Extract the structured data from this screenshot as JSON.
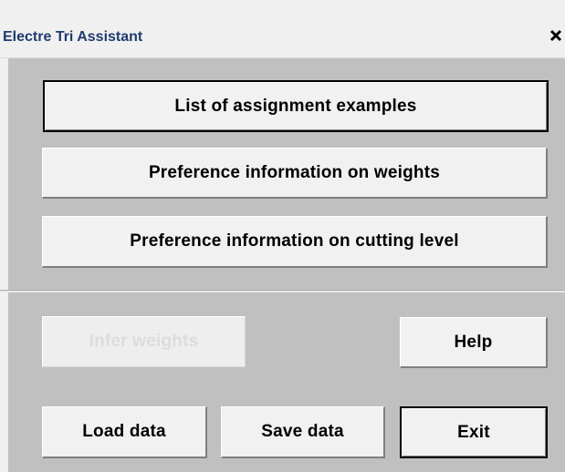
{
  "window": {
    "title": "Electre Tri Assistant",
    "close_glyph": "×"
  },
  "buttons": {
    "list_examples": "List of assignment examples",
    "weights_info": "Preference information on weights",
    "cutting_level_info": "Preference information on cutting level",
    "infer_weights": "Infer weights",
    "help": "Help",
    "load_data": "Load data",
    "save_data": "Save data",
    "exit": "Exit"
  },
  "icons": {
    "close": "close-icon"
  },
  "colors": {
    "title_text": "#1f3b6e",
    "client_background": "#c0c0c0",
    "button_face": "#f1f1f1",
    "disabled_text": "#dcdcdc"
  }
}
